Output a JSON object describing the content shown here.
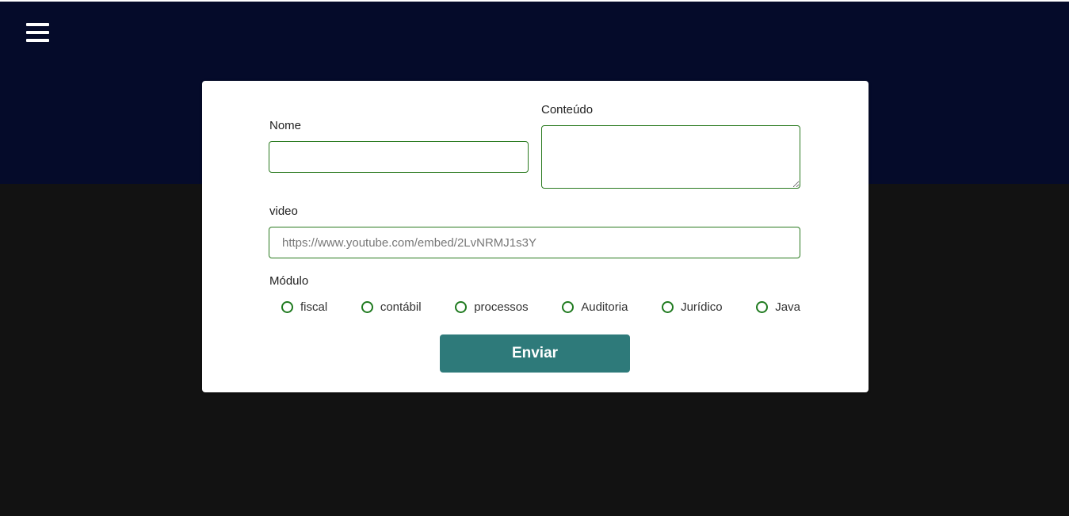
{
  "header": {
    "menu_icon": "hamburger-menu-icon"
  },
  "form": {
    "nome_label": "Nome",
    "nome_value": "",
    "conteudo_label": "Conteúdo",
    "conteudo_value": "",
    "video_label": "video",
    "video_placeholder": "https://www.youtube.com/embed/2LvNRMJ1s3Y",
    "modulo_label": "Módulo",
    "modulo_options": [
      "fiscal",
      "contábil",
      "processos",
      "Auditoria",
      "Jurídico",
      "Java"
    ],
    "submit_label": "Enviar"
  },
  "colors": {
    "header_bg": "#050b2a",
    "page_bg": "#121212",
    "accent_green": "#2a7a1f",
    "button_bg": "#2e7a7a"
  }
}
